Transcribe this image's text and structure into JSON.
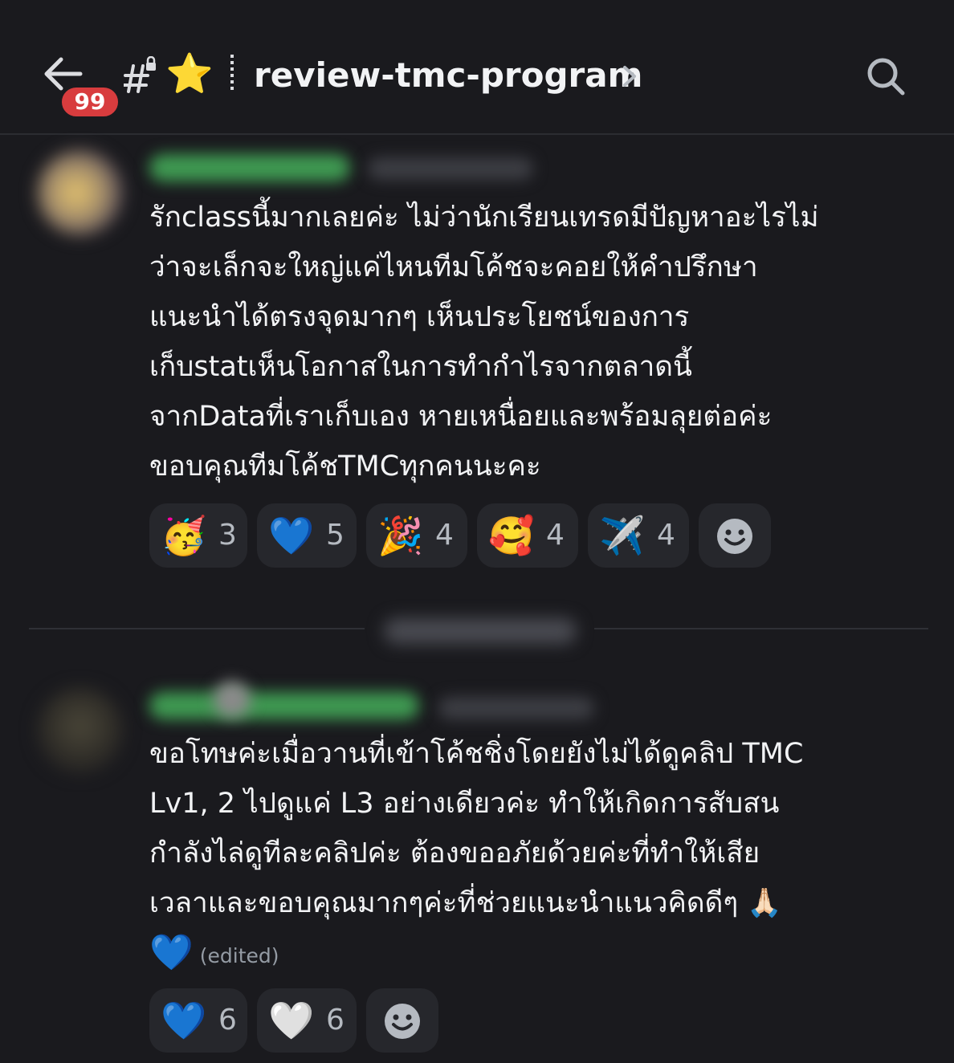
{
  "header": {
    "unread_badge": "99",
    "star_emoji": "⭐",
    "channel_name": "review-tmc-program"
  },
  "messages": [
    {
      "lines": [
        "รักclassนี้มากเลยค่ะ ไม่ว่านักเรียนเทรดมีปัญหาอะไรไม่",
        "ว่าจะเล็กจะใหญ่แค่ไหนทีมโค้ชจะคอยให้คำปรึกษา",
        "แนะนำได้ตรงจุดมากๆ  เห็นประโยชน์ของการ",
        "เก็บstatเห็นโอกาสในการทำกำไรจากตลาดนี้",
        "จากDataที่เราเก็บเอง หายเหนื่อยและพร้อมลุยต่อค่ะ",
        "ขอบคุณทีมโค้ชTMCทุกคนนะคะ"
      ],
      "reactions": [
        {
          "emoji": "🥳",
          "count": "3"
        },
        {
          "emoji": "💙",
          "count": "5"
        },
        {
          "emoji": "🎉",
          "count": "4"
        },
        {
          "emoji": "🥰",
          "count": "4"
        },
        {
          "emoji": "✈️",
          "count": "4"
        }
      ]
    },
    {
      "lines": [
        "ขอโทษค่ะเมื่อวานที่เข้าโค้ชชิ่งโดยยังไม่ได้ดูคลิป TMC",
        "Lv1, 2 ไปดูแค่ L3 อย่างเดียวค่ะ ทำให้เกิดการสับสน",
        "กำลังไล่ดูทีละคลิปค่ะ ต้องขออภัยด้วยค่ะที่ทำให้เสีย",
        "เวลาและขอบคุณมากๆค่ะที่ช่วยแนะนำแนวคิดดีๆ 🙏🏻"
      ],
      "last_line_emoji": "💙",
      "edited_label": "(edited)",
      "reactions": [
        {
          "emoji": "💙",
          "count": "6"
        },
        {
          "emoji": "🤍",
          "count": "6"
        }
      ]
    }
  ]
}
